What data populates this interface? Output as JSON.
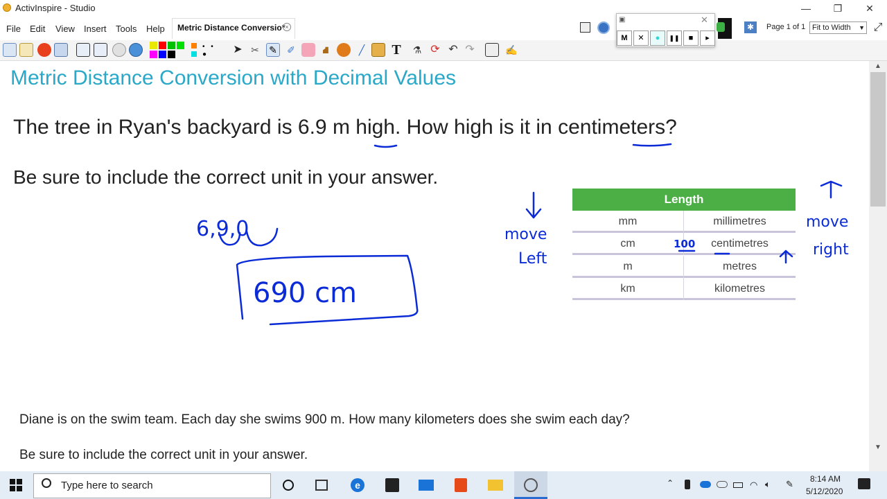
{
  "window": {
    "title": "ActivInspire - Studio",
    "minimize": "—",
    "maximize": "❐",
    "close": "✕"
  },
  "menu": [
    "File",
    "Edit",
    "View",
    "Insert",
    "Tools",
    "Help"
  ],
  "doc_tab": {
    "label": "Metric Distance Conversio*",
    "close": "×"
  },
  "toolbar": {
    "icons": [
      "main-menu-icon",
      "browsers-icon",
      "no-entry-icon",
      "screen-capture-icon",
      "previous-page-icon",
      "next-page-icon",
      "play-icon",
      "globe-icon",
      "color-palette",
      "select-icon",
      "tools-icon",
      "pen-icon",
      "highlighter-icon",
      "eraser-icon",
      "fill-icon",
      "shape-icon",
      "connector-icon",
      "folder-icon",
      "text-tool-icon",
      "clear-icon",
      "reset-icon",
      "undo-icon",
      "redo-icon",
      "flipchart-icon",
      "dual-user-icon"
    ],
    "colors": [
      "#e8e800",
      "#ff0000",
      "#00c000",
      "#ff00ff",
      "#0000ff",
      "#000000",
      "#ff8000",
      "#00e0e0"
    ]
  },
  "recorder": {
    "buttons": [
      "M",
      "✕",
      "●",
      "❚❚",
      "■",
      "▸"
    ],
    "close": "✕"
  },
  "page_info": {
    "label": "Page 1 of 1",
    "zoom": "Fit to Width"
  },
  "content": {
    "title": "Metric Distance Conversion with Decimal Values",
    "question1": "The tree in Ryan's backyard is 6.9 m high. How high is it in centimeters?",
    "question1_instruction": "Be sure to include the correct unit in your answer.",
    "question2": "Diane is on the swim team. Each day she swims 900 m. How many kilometers does she swim each day?",
    "question2_instruction": "Be sure to include the correct unit in your answer."
  },
  "length_table": {
    "header": "Length",
    "rows": [
      {
        "abbr": "mm",
        "name": "millimetres"
      },
      {
        "abbr": "cm",
        "name": "centimetres"
      },
      {
        "abbr": "m",
        "name": "metres"
      },
      {
        "abbr": "km",
        "name": "kilometres"
      }
    ]
  },
  "annotations": {
    "work": "6,9,0",
    "answer": "690 cm",
    "factor": "100",
    "move_left_1": "move",
    "move_left_2": "Left",
    "move_right_1": "move",
    "move_right_2": "right"
  },
  "taskbar": {
    "search_placeholder": "Type here to search",
    "time": "8:14 AM",
    "date": "5/12/2020"
  },
  "colors": {
    "title_blue": "#2aa8c8",
    "table_green": "#4caf46",
    "ink_blue": "#0a2bd6"
  }
}
